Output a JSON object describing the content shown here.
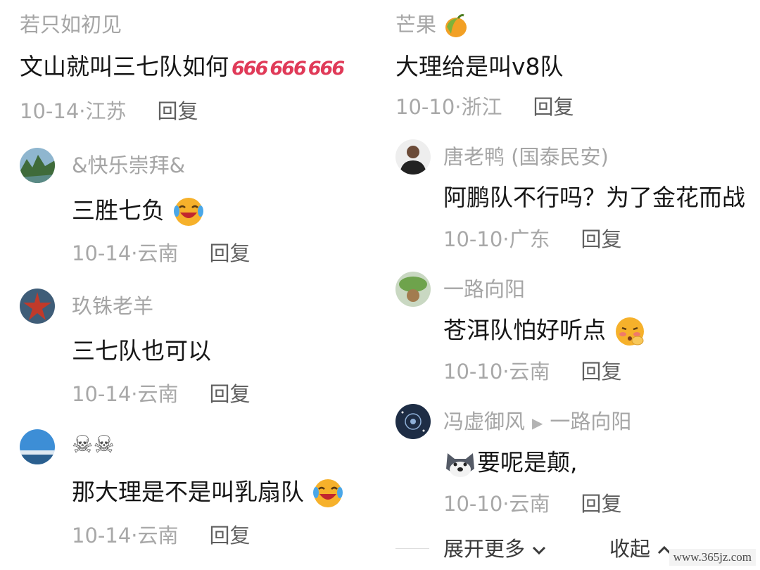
{
  "left_comments": [
    {
      "username": "若只如初见",
      "text": "文山就叫三七队如何",
      "emoji_text": "666",
      "date_location": "10-14·江苏",
      "reply_label": "回复"
    },
    {
      "username": "&快乐崇拜&",
      "text": "三胜七负",
      "date_location": "10-14·云南",
      "reply_label": "回复"
    },
    {
      "username": "玖铢老羊",
      "text": "三七队也可以",
      "date_location": "10-14·云南",
      "reply_label": "回复"
    },
    {
      "username": "☠☠",
      "text": "那大理是不是叫乳扇队",
      "date_location": "10-14·云南",
      "reply_label": "回复"
    }
  ],
  "right_comments": [
    {
      "username": "芒果",
      "text": "大理给是叫v8队",
      "date_location": "10-10·浙江",
      "reply_label": "回复"
    },
    {
      "username": "唐老鸭 (国泰民安)",
      "text": "阿鹏队不行吗？为了金花而战",
      "date_location": "10-10·广东",
      "reply_label": "回复"
    },
    {
      "username": "一路向阳",
      "text": "苍洱队怕好听点",
      "date_location": "10-10·云南",
      "reply_label": "回复"
    },
    {
      "username": "冯虚御风",
      "reply_to": "一路向阳",
      "text": "要呢是颠,",
      "date_location": "10-10·云南",
      "reply_label": "回复"
    }
  ],
  "footer": {
    "expand_label": "展开更多",
    "collapse_label": "收起"
  },
  "watermark": "www.365jz.com",
  "icons": {
    "expand": "chevron-down-icon",
    "collapse": "chevron-up-icon",
    "reply_arrow": "triangle-right-icon"
  }
}
